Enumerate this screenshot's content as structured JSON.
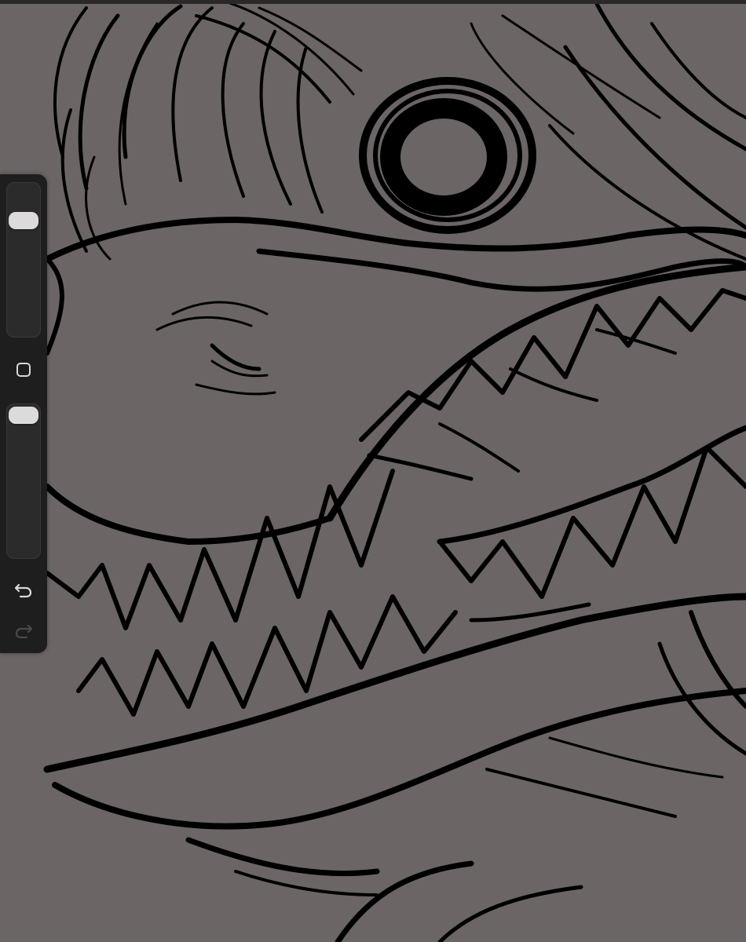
{
  "app": {
    "canvas_background": "#6b6566",
    "line_color": "#000000",
    "toolbar_color": "#1f1e1f"
  },
  "sidebar": {
    "brush_size_slider": {
      "level": 0.8
    },
    "brush_opacity_slider": {
      "level": 1.0
    },
    "modify_button_icon": "square-icon",
    "undo_icon": "undo-arrow-icon",
    "redo_icon": "redo-arrow-icon",
    "redo_enabled": false
  }
}
